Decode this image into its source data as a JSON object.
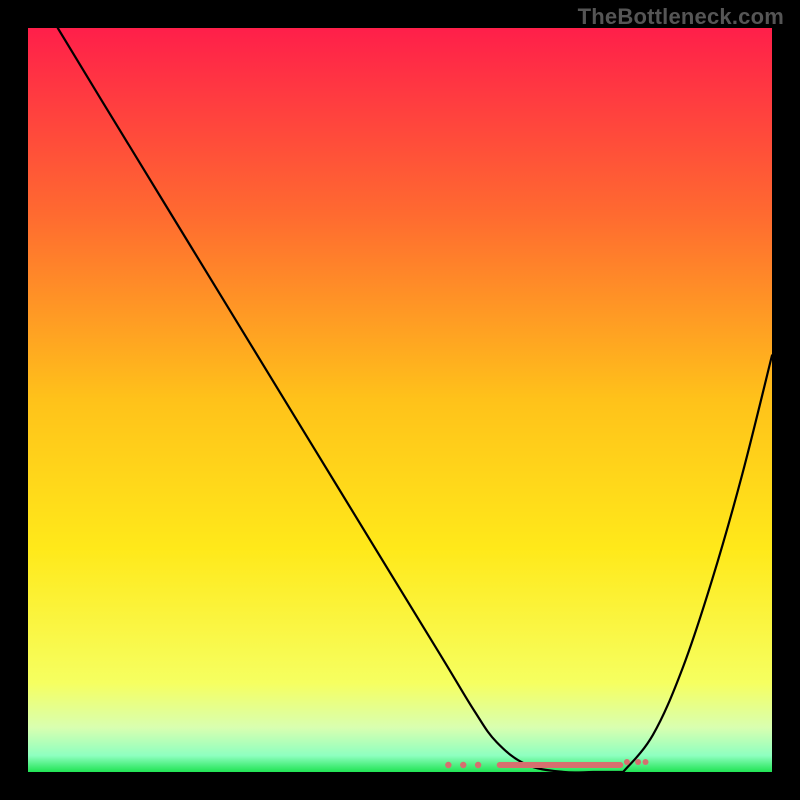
{
  "watermark": "TheBottleneck.com",
  "colors": {
    "background": "#000000",
    "watermark": "#555555",
    "curve": "#000000",
    "accent": "#d66f6f",
    "bottom_band_green": "#20e454"
  },
  "chart_data": {
    "type": "line",
    "title": "",
    "xlabel": "",
    "ylabel": "",
    "xlim": [
      0,
      100
    ],
    "ylim": [
      0,
      100
    ],
    "gradient_stops": [
      {
        "offset": 0.0,
        "color": "#ff1f4a"
      },
      {
        "offset": 0.25,
        "color": "#ff6a30"
      },
      {
        "offset": 0.5,
        "color": "#ffc21a"
      },
      {
        "offset": 0.7,
        "color": "#ffe91a"
      },
      {
        "offset": 0.88,
        "color": "#f6ff60"
      },
      {
        "offset": 0.94,
        "color": "#d9ffb0"
      },
      {
        "offset": 0.978,
        "color": "#8effc0"
      },
      {
        "offset": 1.0,
        "color": "#20e454"
      }
    ],
    "series": [
      {
        "name": "left-branch",
        "x": [
          4,
          10,
          18,
          26,
          34,
          42,
          50,
          56,
          60,
          63,
          67,
          72,
          76,
          80
        ],
        "y": [
          100,
          90.1,
          77.0,
          63.9,
          50.8,
          37.7,
          24.6,
          14.8,
          8.2,
          4.0,
          1.0,
          0.0,
          0.0,
          0.0
        ]
      },
      {
        "name": "right-branch",
        "x": [
          80,
          84,
          88,
          92,
          96,
          100
        ],
        "y": [
          0.0,
          5.0,
          14.0,
          26.0,
          40.0,
          56.0
        ]
      }
    ],
    "notch_x_range": [
      56,
      80
    ],
    "notch_band_y": [
      0,
      1.5
    ]
  }
}
